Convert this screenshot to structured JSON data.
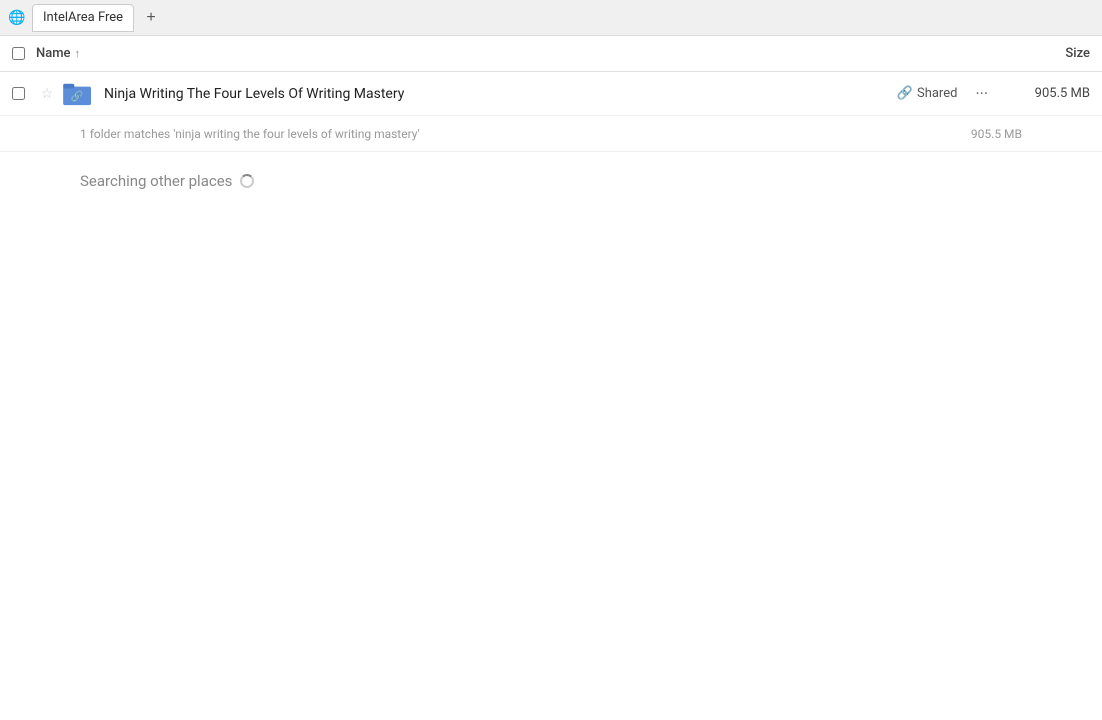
{
  "titlebar": {
    "app_icon": "🌐",
    "tab_label": "IntelArea Free",
    "add_tab_label": "+"
  },
  "columns": {
    "name_label": "Name",
    "sort_indicator": "↑",
    "size_label": "Size"
  },
  "file_row": {
    "name": "Ninja Writing The Four Levels Of Writing Mastery",
    "shared_label": "Shared",
    "size": "905.5 MB"
  },
  "match_info": {
    "text": "1 folder matches 'ninja writing the four levels of writing mastery'",
    "size": "905.5 MB"
  },
  "searching": {
    "label": "Searching other places"
  }
}
